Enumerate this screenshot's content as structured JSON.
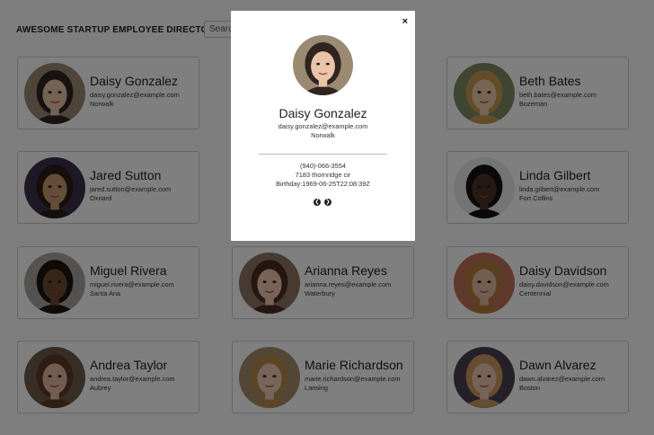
{
  "header": {
    "title": "AWESOME STARTUP EMPLOYEE DIRECTORY",
    "search_placeholder": "Search..."
  },
  "employees": [
    {
      "name": "Daisy Gonzalez",
      "email": "daisy.gonzalez@example.com",
      "city": "Norwalk",
      "avatar_colors": {
        "bg": "#9b8a72",
        "skin": "#e8c4a8",
        "hair": "#2f2420"
      }
    },
    {
      "name": "Jared Sutton",
      "email": "jared.sutton@example.com",
      "city": "Oxnard",
      "avatar_colors": {
        "bg": "#3d2f4a",
        "skin": "#c99a72",
        "hair": "#2a1d15"
      }
    },
    {
      "name": "Miguel Rivera",
      "email": "miguel.rivera@example.com",
      "city": "Santa Ana",
      "avatar_colors": {
        "bg": "#a9a49c",
        "skin": "#6e4a34",
        "hair": "#1d1511"
      }
    },
    {
      "name": "Andrea Taylor",
      "email": "andrea.taylor@example.com",
      "city": "Aubrey",
      "avatar_colors": {
        "bg": "#6f5a4a",
        "skin": "#e2b8a2",
        "hair": "#5a3a2a"
      }
    },
    {
      "name": "Arianna Reyes",
      "email": "arianna.reyes@example.com",
      "city": "Waterbury",
      "avatar_colors": {
        "bg": "#8c7562",
        "skin": "#efc7b0",
        "hair": "#4b2c20"
      }
    },
    {
      "name": "Marie Richardson",
      "email": "marie.richardson@example.com",
      "city": "Lansing",
      "avatar_colors": {
        "bg": "#a88c6e",
        "skin": "#edcbb0",
        "hair": "#b98a4e"
      }
    },
    {
      "name": "Beth Bates",
      "email": "beth.bates@example.com",
      "city": "Bozeman",
      "avatar_colors": {
        "bg": "#7c8a60",
        "skin": "#efc9a6",
        "hair": "#c79a52"
      }
    },
    {
      "name": "Linda Gilbert",
      "email": "linda.gilbert@example.com",
      "city": "Fort Collins",
      "avatar_colors": {
        "bg": "#e8e8e8",
        "skin": "#4b3226",
        "hair": "#171112"
      }
    },
    {
      "name": "Daisy Davidson",
      "email": "daisy.davidson@example.com",
      "city": "Centennial",
      "avatar_colors": {
        "bg": "#c0735a",
        "skin": "#e7b8a0",
        "hair": "#b77a40"
      }
    },
    {
      "name": "Dawn Alvarez",
      "email": "dawn.alvarez@example.com",
      "city": "Boston",
      "avatar_colors": {
        "bg": "#4a4150",
        "skin": "#ecc7ad",
        "hair": "#c99a60"
      }
    }
  ],
  "modal": {
    "close_icon": "×",
    "name": "Daisy Gonzalez",
    "email": "daisy.gonzalez@example.com",
    "city": "Norwalk",
    "phone": "(940)-066-3554",
    "address": "7183 thornridge cir",
    "birthday": "Birthday:1969-06-25T22:08:39Z",
    "prev_icon": "❮",
    "next_icon": "❯"
  },
  "colors": {
    "overlay": "rgba(0,0,0,0.50)",
    "card_border": "#cfcfcf"
  }
}
